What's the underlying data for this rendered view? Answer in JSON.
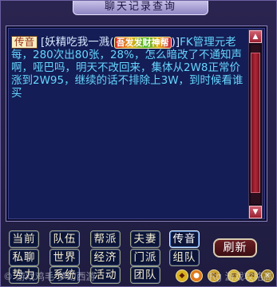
{
  "window": {
    "title": "聊天记录查询"
  },
  "chat": {
    "channel_tag": "传音",
    "sender_prefix": "[妖精吃我一溅(",
    "badge": "吾发发财神帮",
    "sender_suffix": ")]",
    "message": "FK管理元老每，280次出80张，28%，怎么暗改了不通知声啊，哑巴吗，明天不改回来，集体从2W8正常价涨到2W95，继续的话不排除上3W，到时候看谁买"
  },
  "scrollbar": {
    "up": "▲",
    "down": "▼"
  },
  "channels": {
    "current": "当前",
    "team": "队伍",
    "gang": "帮派",
    "spouse": "夫妻",
    "transmit": "传音",
    "private": "私聊",
    "world": "世界",
    "economy": "经济",
    "faction": "门派",
    "group": "组队",
    "guild": "势力",
    "system": "系统",
    "activity": "活动",
    "squad": "团队"
  },
  "refresh_label": "刷新",
  "watermark": {
    "left": "© 游戏鸡毛 梦幻西游",
    "right": "Rg 游戏攻略高手"
  },
  "colors": {
    "message_text": "#66d6ff",
    "channel_tag_bg": "#f5eec2",
    "window_bg": "#1f1c40",
    "chat_bg": "#141d55",
    "refresh_bg": "#6b1e22"
  }
}
